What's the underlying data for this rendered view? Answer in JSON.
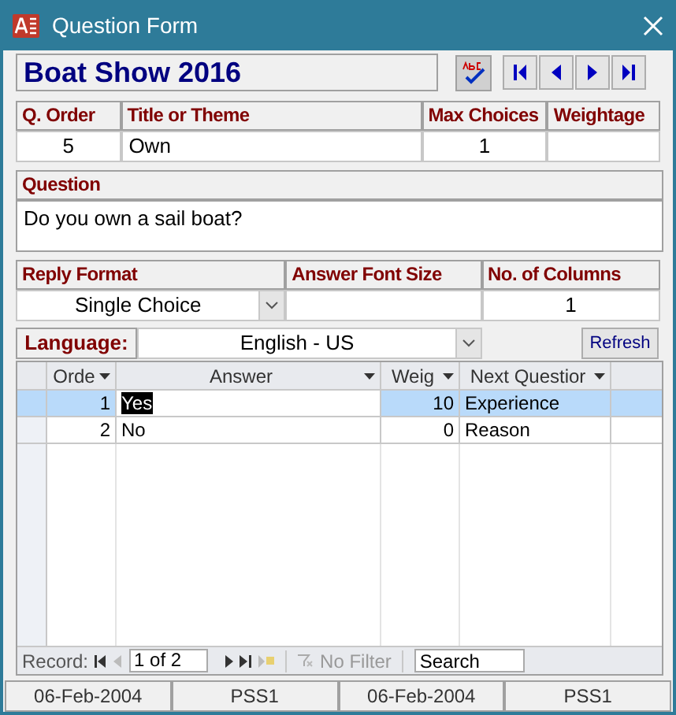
{
  "window": {
    "title": "Question Form"
  },
  "survey_title": "Boat Show 2016",
  "question_fields": {
    "headers": [
      "Q. Order",
      "Title or Theme",
      "Max Choices",
      "Weightage"
    ],
    "values": [
      "5",
      "Own",
      "1"
    ]
  },
  "question": {
    "label": "Question",
    "value": "Do you own a sail boat?"
  },
  "format_fields": {
    "headers": [
      "Reply Format",
      "Answer Font Size",
      "No. of Columns"
    ],
    "reply_format": "Single Choice",
    "columns": "1"
  },
  "language": {
    "label": "Language:",
    "value": "English - US"
  },
  "refresh_button": "Refresh",
  "answers": {
    "columns": [
      "Orde",
      "Answer",
      "Weig",
      "Next Questior"
    ],
    "rows": [
      {
        "cells": [
          "1",
          "Yes",
          "10",
          "Experience"
        ],
        "selected": true
      },
      {
        "cells": [
          "2",
          "No",
          "0",
          "Reason"
        ],
        "selected": false
      }
    ]
  },
  "record_nav": {
    "label": "Record:",
    "position": "1 of 2",
    "filter": "No Filter",
    "search_placeholder": "Search"
  },
  "status_bar": [
    "06-Feb-2004",
    "PSS1",
    "06-Feb-2004",
    "PSS1"
  ]
}
